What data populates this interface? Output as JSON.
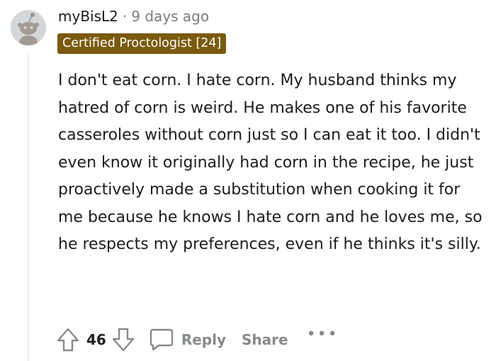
{
  "comment": {
    "username": "myBisL2",
    "separator": "·",
    "timestamp": "9 days ago",
    "flair": "Certified Proctologist [24]",
    "body": "I don't eat corn. I hate corn. My husband thinks my hatred of corn is weird. He makes one of his favorite casseroles without corn just so I can eat it too. I didn't even know it originally had corn in the recipe, he just proactively made a substitution when cooking it for me because he knows I hate corn and he loves me, so he respects my preferences, even if he thinks it's silly."
  },
  "actions": {
    "vote_count": "46",
    "reply_label": "Reply",
    "share_label": "Share",
    "more_label": "•••"
  },
  "icons": {
    "avatar": "snoo-avatar-icon",
    "upvote": "upvote-arrow-icon",
    "downvote": "downvote-arrow-icon",
    "reply": "speech-bubble-icon",
    "more": "ellipsis-icon"
  },
  "colors": {
    "flair_background": "#7a5a0d",
    "flair_text": "#ffffff",
    "text_primary": "#1c1c1c",
    "text_muted": "#787c7e",
    "icon_gray": "#878a8c"
  }
}
